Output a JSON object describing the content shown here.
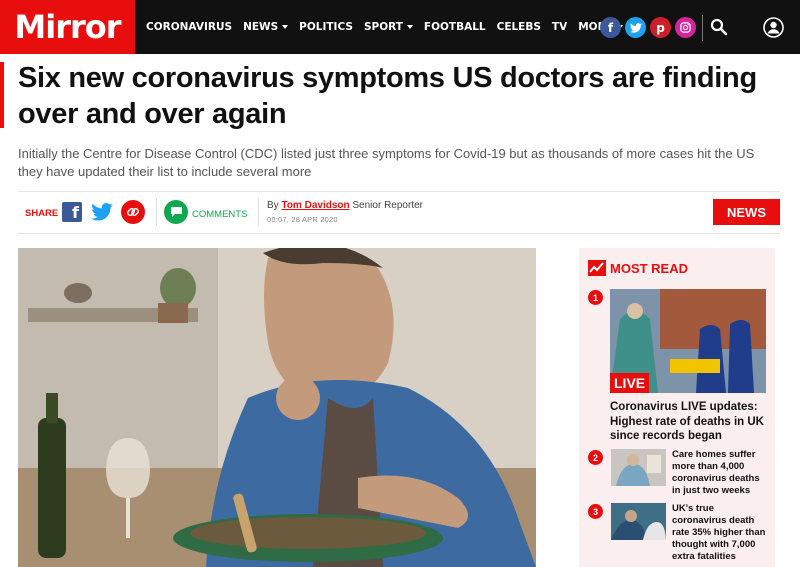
{
  "header": {
    "logo": "Mirror",
    "nav": [
      {
        "label": "CORONAVIRUS",
        "dropdown": false
      },
      {
        "label": "NEWS",
        "dropdown": true
      },
      {
        "label": "POLITICS",
        "dropdown": false
      },
      {
        "label": "SPORT",
        "dropdown": true
      },
      {
        "label": "FOOTBALL",
        "dropdown": false
      },
      {
        "label": "CELEBS",
        "dropdown": false
      },
      {
        "label": "TV",
        "dropdown": false
      },
      {
        "label": "MORE",
        "dropdown": true
      }
    ],
    "social_icons": [
      "facebook-icon",
      "twitter-icon",
      "pinterest-icon",
      "instagram-icon"
    ]
  },
  "article": {
    "headline": "Six new coronavirus symptoms US doctors are finding over and over again",
    "standfirst": "Initially the Centre for Disease Control (CDC) listed just three symptoms for Covid-19 but as thousands of more cases hit the US they have updated their list to include several more",
    "share_label": "SHARE",
    "comments_label": "COMMENTS",
    "byline_prefix": "By",
    "author": "Tom Davidson",
    "author_role": "Senior Reporter",
    "dateline": "00:07, 28 APR 2020",
    "section_badge": "NEWS"
  },
  "most_read": {
    "title": "MOST READ",
    "items": [
      {
        "rank": "1",
        "title": "Coronavirus LIVE updates: Highest rate of deaths in UK since records began",
        "tag": "LIVE"
      },
      {
        "rank": "2",
        "title": "Care homes suffer more than 4,000 coronavirus deaths in just two weeks"
      },
      {
        "rank": "3",
        "title": "UK's true coronavirus death rate 35% higher than thought with 7,000 extra fatalities"
      }
    ]
  },
  "colors": {
    "brand_red": "#e90e0e",
    "topbar": "#111111",
    "comments_green": "#10a84f",
    "most_read_bg": "#fbeeee"
  }
}
